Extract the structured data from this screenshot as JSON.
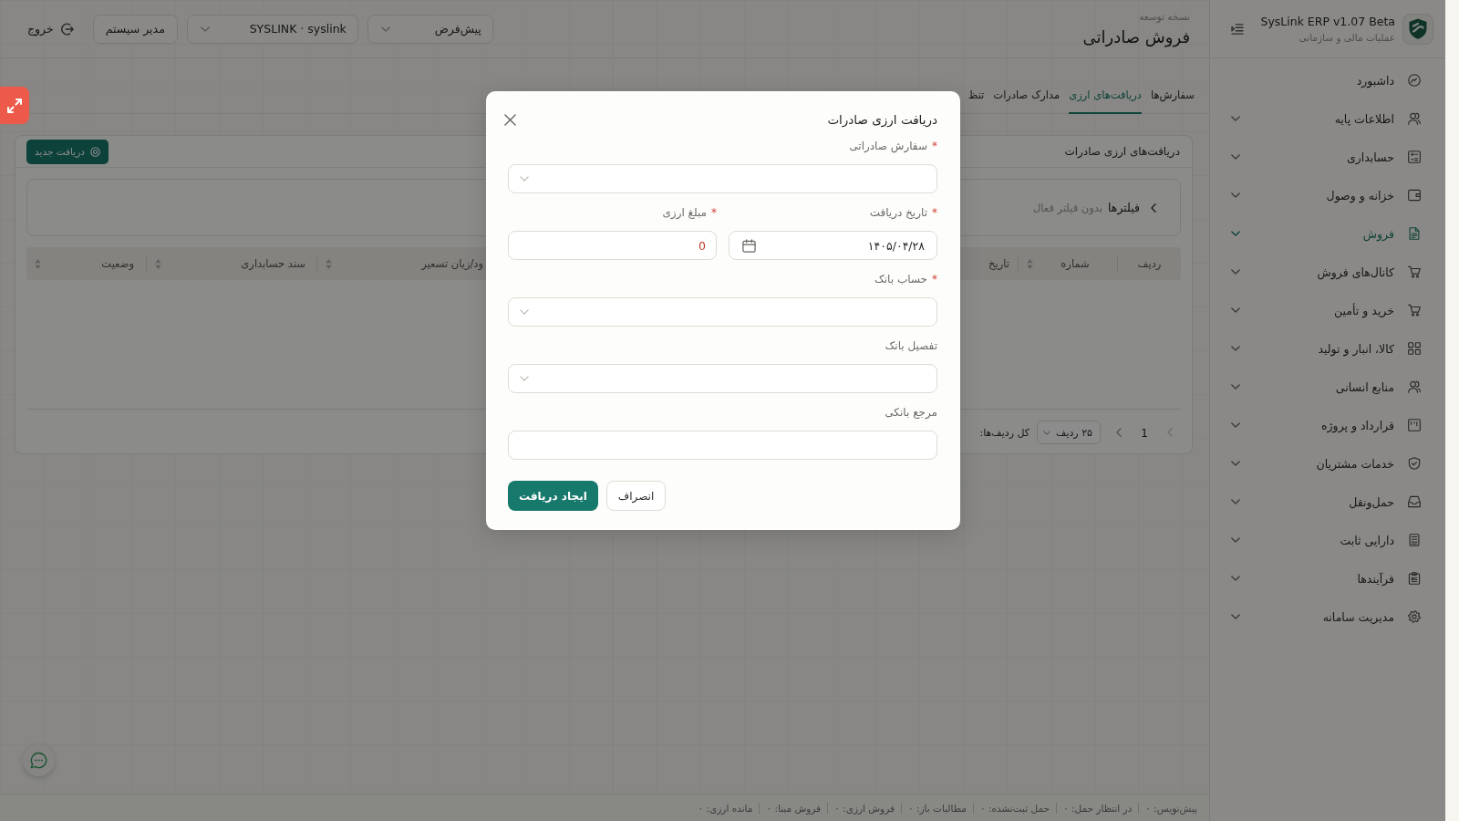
{
  "sidebar": {
    "app_name": "SysLink ERP v1.07 Beta",
    "app_subtitle": "عملیات مالی و سازمانی",
    "items": [
      {
        "label": "داشبورد",
        "has_submenu": false,
        "selected": false
      },
      {
        "label": "اطلاعات پایه",
        "has_submenu": true,
        "selected": false
      },
      {
        "label": "حسابداری",
        "has_submenu": true,
        "selected": false
      },
      {
        "label": "خزانه و وصول",
        "has_submenu": true,
        "selected": false
      },
      {
        "label": "فروش",
        "has_submenu": true,
        "selected": true
      },
      {
        "label": "کانال‌های فروش",
        "has_submenu": true,
        "selected": false
      },
      {
        "label": "خرید و تأمین",
        "has_submenu": true,
        "selected": false
      },
      {
        "label": "کالا، انبار و تولید",
        "has_submenu": true,
        "selected": false
      },
      {
        "label": "منابع انسانی",
        "has_submenu": true,
        "selected": false
      },
      {
        "label": "قرارداد و پروژه",
        "has_submenu": true,
        "selected": false
      },
      {
        "label": "خدمات مشتریان",
        "has_submenu": true,
        "selected": false
      },
      {
        "label": "حمل‌ونقل",
        "has_submenu": true,
        "selected": false
      },
      {
        "label": "دارایی ثابت",
        "has_submenu": true,
        "selected": false
      },
      {
        "label": "فرآیندها",
        "has_submenu": true,
        "selected": false
      },
      {
        "label": "مدیریت سامانه",
        "has_submenu": true,
        "selected": false
      }
    ]
  },
  "header": {
    "subtitle": "نسخه توسعه",
    "title": "فروش صادراتی",
    "controls": [
      {
        "kind": "select",
        "value": "پیش‌فرض"
      },
      {
        "kind": "select",
        "value": "SYSLINK · syslink"
      },
      {
        "kind": "button",
        "label": "مدیر سیستم"
      },
      {
        "kind": "logout",
        "label": "خروج"
      }
    ]
  },
  "tabs": [
    {
      "label": "سفارش‌ها",
      "selected": false
    },
    {
      "label": "دریافت‌های ارزی",
      "selected": true
    },
    {
      "label": "مدارک صادرات",
      "selected": false
    },
    {
      "label": "تنظ",
      "selected": false
    }
  ],
  "receipts_card": {
    "title": "دریافت‌های ارزی صادرات",
    "new_button": "دریافت جدید",
    "filter_toggle": "فیلترها",
    "filter_status": "بدون فیلتر فعال",
    "columns": [
      {
        "label": "ردیف",
        "sortable": false
      },
      {
        "label": "شماره",
        "sortable": true
      },
      {
        "label": "تاریخ",
        "sortable": false
      },
      {
        "label": "ود/زیان تسعیر",
        "sortable": true
      },
      {
        "label": "سند حسابداری",
        "sortable": true
      },
      {
        "label": "وضعیت",
        "sortable": true
      }
    ],
    "pagination": {
      "page": "1",
      "page_size": "۲۵ ردیف",
      "total_label": "کل ردیف‌ها:"
    }
  },
  "status_bar": [
    "پیش‌نویس: ۰",
    "در انتظار حمل: ۰",
    "حمل ثبت‌نشده: ۰",
    "مطالبات باز: ۰",
    "فروش ارزی: ۰",
    "فروش مبنا: ۰",
    "مانده ارزی: ۰"
  ],
  "modal": {
    "title": "دریافت ارزی صادرات",
    "rows": [
      [
        {
          "kind": "select",
          "label": "سفارش صادراتی",
          "required_mark": "*"
        }
      ],
      [
        {
          "kind": "date",
          "label": "تاریخ دریافت",
          "required_mark": "*",
          "value": "۱۴۰۵/۰۴/۲۸"
        },
        {
          "kind": "number",
          "label": "مبلغ ارزی",
          "required_mark": "*",
          "value": "0"
        }
      ],
      [
        {
          "kind": "select",
          "label": "حساب بانک",
          "required_mark": "*"
        }
      ],
      [
        {
          "kind": "select",
          "label": "تفصیل بانک"
        }
      ],
      [
        {
          "kind": "text",
          "label": "مرجع بانکی"
        }
      ]
    ],
    "buttons": [
      {
        "kind": "default",
        "label": "انصراف"
      },
      {
        "kind": "primary",
        "label": "ایجاد دریافت"
      }
    ]
  }
}
